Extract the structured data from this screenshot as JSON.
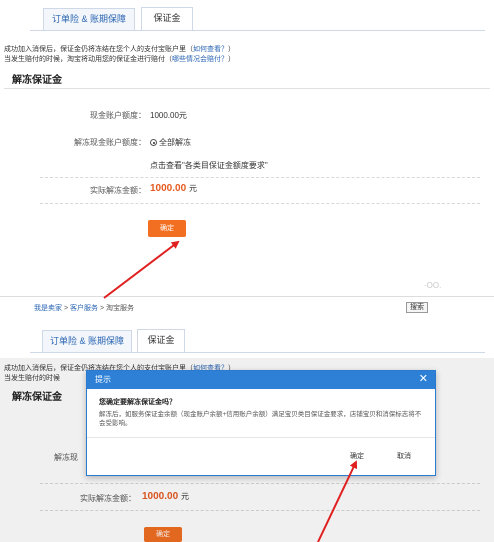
{
  "top": {
    "tabs": [
      {
        "label": "订单险 & 账期保障",
        "active": false
      },
      {
        "label": "保证金",
        "active": true
      }
    ],
    "notes": [
      {
        "text": "成功加入消保后，保证金仍将冻结在您个人的支付宝账户里（",
        "link": "如何查看？",
        "tail": "）"
      },
      {
        "text": "当发生赔付的时候，淘宝将动用您的保证金进行赔付（",
        "link": "哪些情况会赔付？",
        "tail": "）"
      }
    ],
    "section_title": "解冻保证金",
    "balance_label": "现金账户额度：",
    "balance_value": "1000.00元",
    "unfreeze_label": "解冻现金账户额度：",
    "unfreeze_option": "全部解冻",
    "requirement_link": "点击查看\"各类目保证金额度要求\"",
    "actual_label": "实际解冻金额：",
    "actual_value": "1000.00",
    "actual_unit": "元",
    "confirm_label": "确定"
  },
  "watermark": "·OO.",
  "nav": {
    "breadcrumb": [
      "我是卖家",
      "客户服务",
      "淘宝服务"
    ],
    "separator": ">",
    "search_label": "搜索"
  },
  "bottom": {
    "tabs": [
      {
        "label": "订单险 & 账期保障",
        "active": false
      },
      {
        "label": "保证金",
        "active": true
      }
    ],
    "notes": [
      {
        "text": "成功加入消保后，保证金仍将冻结在您个人的支付宝账户里（",
        "link": "如何查看？",
        "tail": "）"
      },
      {
        "text": "当发生赔付的时候"
      }
    ],
    "section_title": "解冻保证金",
    "partial_label_1": "解冻现",
    "actual_label": "实际解冻金额：",
    "actual_value": "1000.00",
    "actual_unit": "元",
    "confirm_label": "确定"
  },
  "dialog": {
    "title": "提示",
    "close": "✕",
    "question": "您确定要解冻保证金吗？",
    "message": "解冻后，如服务保证金余额（现金账户余额+信用账户余额）满足宝贝类目保证金要求，店铺宝贝和消保标志将不会受影响。",
    "ok_label": "确定",
    "cancel_label": "取消"
  },
  "colors": {
    "accent": "#f26f21",
    "link": "#2a65b3",
    "dialog_header": "#2d80d6",
    "amount": "#e65a1f"
  }
}
